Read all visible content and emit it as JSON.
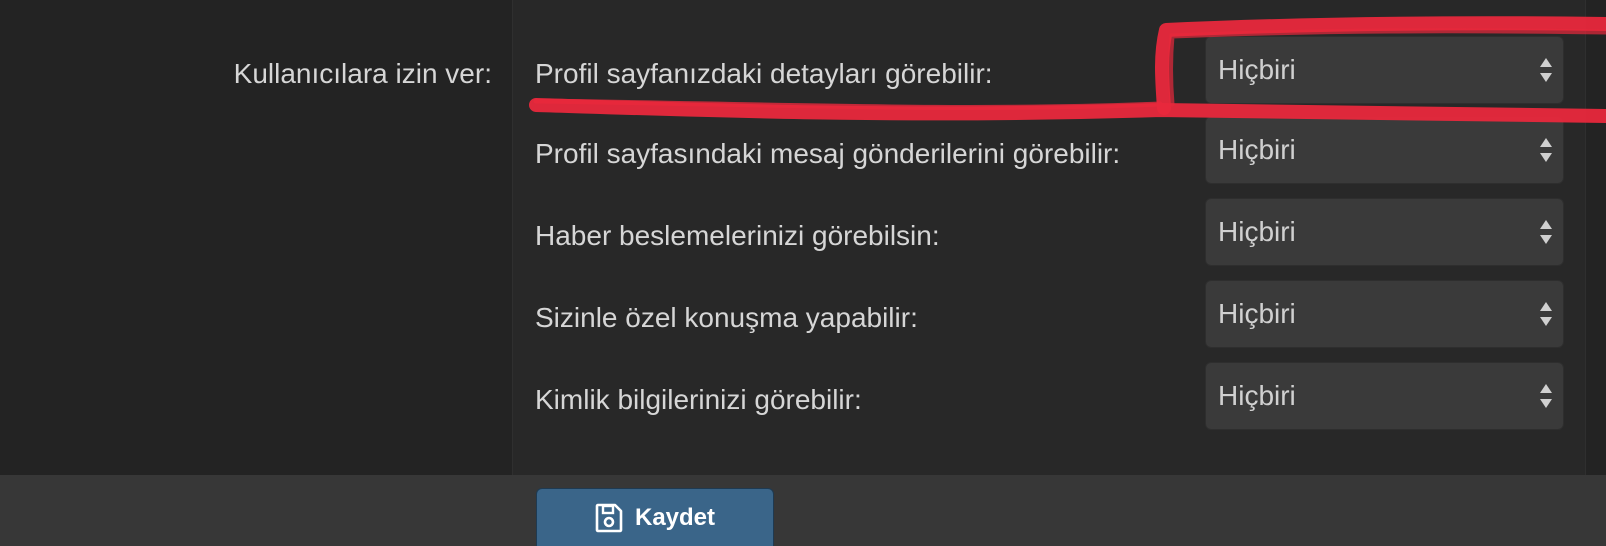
{
  "section_label": "Kullanıcılara izin ver:",
  "rows": [
    {
      "label": "Profil sayfanızdaki detayları görebilir:",
      "value": "Hiçbiri"
    },
    {
      "label": "Profil sayfasındaki mesaj gönderilerini görebilir:",
      "value": "Hiçbiri"
    },
    {
      "label": "Haber beslemelerinizi görebilsin:",
      "value": "Hiçbiri"
    },
    {
      "label": "Sizinle özel konuşma yapabilir:",
      "value": "Hiçbiri"
    },
    {
      "label": "Kimlik bilgilerinizi görebilir:",
      "value": "Hiçbiri"
    }
  ],
  "save_button": {
    "label": "Kaydet",
    "icon": "floppy-disk-icon"
  },
  "colors": {
    "button_bg": "#3a6589",
    "annotation": "#e8283c"
  }
}
